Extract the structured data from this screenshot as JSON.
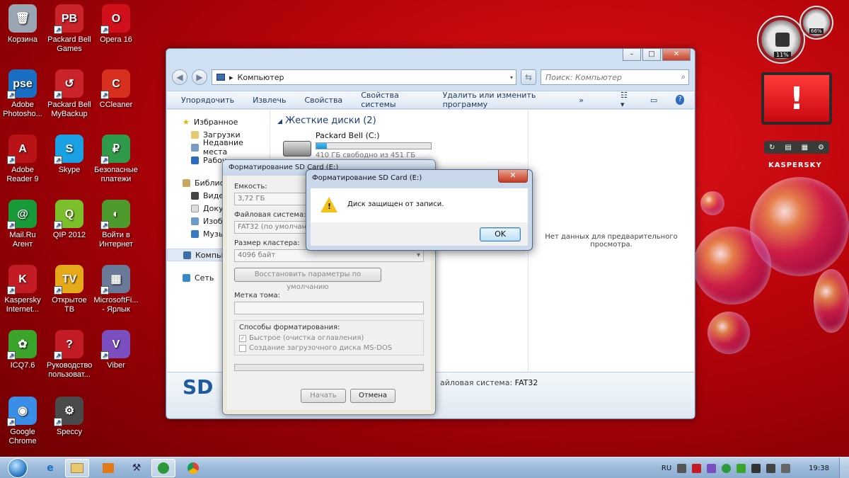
{
  "desktop": {
    "icons": [
      {
        "label": "Корзина",
        "color": "#9aa6b2",
        "glyph": "🗑"
      },
      {
        "label": "Packard Bell Games",
        "color": "#c8242a",
        "glyph": "PB"
      },
      {
        "label": "Opera 16",
        "color": "#d0101a",
        "glyph": "O"
      },
      {
        "label": "Adobe Photosho...",
        "color": "#1b6fc3",
        "glyph": "pse"
      },
      {
        "label": "Packard Bell MyBackup",
        "color": "#c8242a",
        "glyph": "↺"
      },
      {
        "label": "CCleaner",
        "color": "#d8301e",
        "glyph": "C"
      },
      {
        "label": "Adobe Reader 9",
        "color": "#b81418",
        "glyph": "A"
      },
      {
        "label": "Skype",
        "color": "#1aa1e4",
        "glyph": "S"
      },
      {
        "label": "Безопасные платежи",
        "color": "#2f9a4a",
        "glyph": "₽"
      },
      {
        "label": "Mail.Ru Агент",
        "color": "#1a9b3a",
        "glyph": "@"
      },
      {
        "label": "QIP 2012",
        "color": "#7bbf2a",
        "glyph": "Q"
      },
      {
        "label": "Войти в Интернет",
        "color": "#4e9a2c",
        "glyph": "◐"
      },
      {
        "label": "Kaspersky Internet...",
        "color": "#c41c24",
        "glyph": "K"
      },
      {
        "label": "Открытое ТВ",
        "color": "#e6a91a",
        "glyph": "TV"
      },
      {
        "label": "MicrosoftFi... - Ярлык",
        "color": "#6a7a98",
        "glyph": "▦"
      },
      {
        "label": "ICQ7.6",
        "color": "#3aa52a",
        "glyph": "✿"
      },
      {
        "label": "Руководство пользоват...",
        "color": "#c41c24",
        "glyph": "?"
      },
      {
        "label": "Viber",
        "color": "#7b4fbf",
        "glyph": "V"
      },
      {
        "label": "Google Chrome",
        "color": "#3a8ee6",
        "glyph": "◉"
      },
      {
        "label": "Speccy",
        "color": "#4a4a4a",
        "glyph": "⚙"
      }
    ]
  },
  "gadget": {
    "cpu": "11%",
    "mem": "66%",
    "brand": "KASPERSKY"
  },
  "explorer": {
    "address": "Компьютер",
    "search_placeholder": "Поиск: Компьютер",
    "toolbar": [
      "Упорядочить",
      "Извлечь",
      "Свойства",
      "Свойства системы",
      "Удалить или изменить программу",
      "»"
    ],
    "nav": {
      "favorites": "Избранное",
      "downloads": "Загрузки",
      "recent": "Недавние места",
      "desktop": "Рабоч",
      "libraries": "Библио",
      "video": "Видео",
      "docs": "Докум",
      "images": "Изобр",
      "music": "Музы",
      "computer": "Компью",
      "network": "Сеть"
    },
    "group_header": "Жесткие диски (2)",
    "drive": {
      "name": "Packard Bell (C:)",
      "free": "410 ГБ свободно из 451 ГБ",
      "used_fraction": 0.09
    },
    "preview_text": "Нет данных для предварительного просмотра.",
    "details": {
      "label": "SD",
      "fs": "айловая система:",
      "fs_value": "FAT32"
    }
  },
  "format_dialog": {
    "title": "Форматирование SD Card (E:)",
    "capacity_label": "Емкость:",
    "capacity_value": "3,72 ГБ",
    "fs_label": "Файловая система:",
    "fs_value": "FAT32 (по умолчанию)",
    "cluster_label": "Размер кластера:",
    "cluster_value": "4096 байт",
    "restore_button": "Восстановить параметры по умолчанию",
    "volume_label": "Метка тома:",
    "volume_value": "",
    "options_label": "Способы форматирования:",
    "quick_format": "Быстрое (очистка оглавления)",
    "msdos_disk": "Создание загрузочного диска MS-DOS",
    "start_button": "Начать",
    "cancel_button": "Отмена"
  },
  "alert": {
    "title": "Форматирование SD Card (E:)",
    "close": "✕",
    "message": "Диск защищен от записи.",
    "ok": "OK"
  },
  "taskbar": {
    "lang": "RU",
    "time": "19:38"
  }
}
